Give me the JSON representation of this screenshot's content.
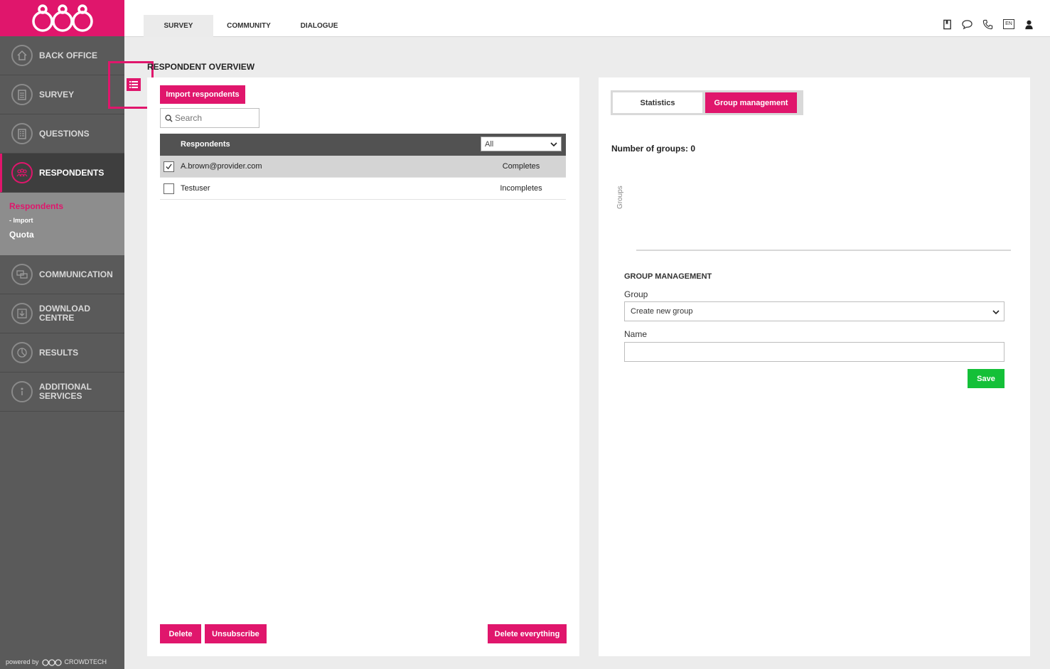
{
  "colors": {
    "accent": "#e0166c",
    "sidebar": "#5a5a5a",
    "save": "#14c038"
  },
  "topbar": {
    "tabs": [
      {
        "label": "SURVEY"
      },
      {
        "label": "COMMUNITY"
      },
      {
        "label": "DIALOGUE"
      }
    ],
    "icons": [
      "book-icon",
      "chat-icon",
      "phone-icon",
      "language-icon",
      "user-icon"
    ],
    "language": "EN"
  },
  "sidebar": {
    "items": [
      {
        "label": "BACK OFFICE",
        "icon": "home-icon"
      },
      {
        "label": "SURVEY",
        "icon": "clipboard-icon"
      },
      {
        "label": "QUESTIONS",
        "icon": "questions-icon"
      },
      {
        "label": "RESPONDENTS",
        "icon": "people-icon"
      },
      {
        "label": "COMMUNICATION",
        "icon": "chat-bubbles-icon"
      },
      {
        "label": "DOWNLOAD CENTRE",
        "icon": "download-icon"
      },
      {
        "label": "RESULTS",
        "icon": "pie-chart-icon"
      },
      {
        "label": "ADDITIONAL SERVICES",
        "icon": "info-icon"
      }
    ],
    "subnav": {
      "respondents": "Respondents",
      "import": "-  Import",
      "quota": "Quota"
    },
    "powered_by": "powered by",
    "brand": "CROWDTECH"
  },
  "page": {
    "title": "RESPONDENT OVERVIEW"
  },
  "left": {
    "import_button": "Import respondents",
    "search_placeholder": "Search",
    "table_header": "Respondents",
    "filter_value": "All",
    "rows": [
      {
        "name": "A.brown@provider.com",
        "status": "Completes",
        "checked": true
      },
      {
        "name": "Testuser",
        "status": "Incompletes",
        "checked": false
      }
    ],
    "delete_button": "Delete",
    "unsubscribe_button": "Unsubscribe",
    "delete_all_button": "Delete everything"
  },
  "right": {
    "tab_statistics": "Statistics",
    "tab_group_management": "Group management",
    "group_count": "Number of groups: 0",
    "chart_ylabel": "Groups",
    "section_title": "GROUP MANAGEMENT",
    "group_label": "Group",
    "group_select_value": "Create new group",
    "name_label": "Name",
    "name_value": "",
    "save_button": "Save"
  }
}
